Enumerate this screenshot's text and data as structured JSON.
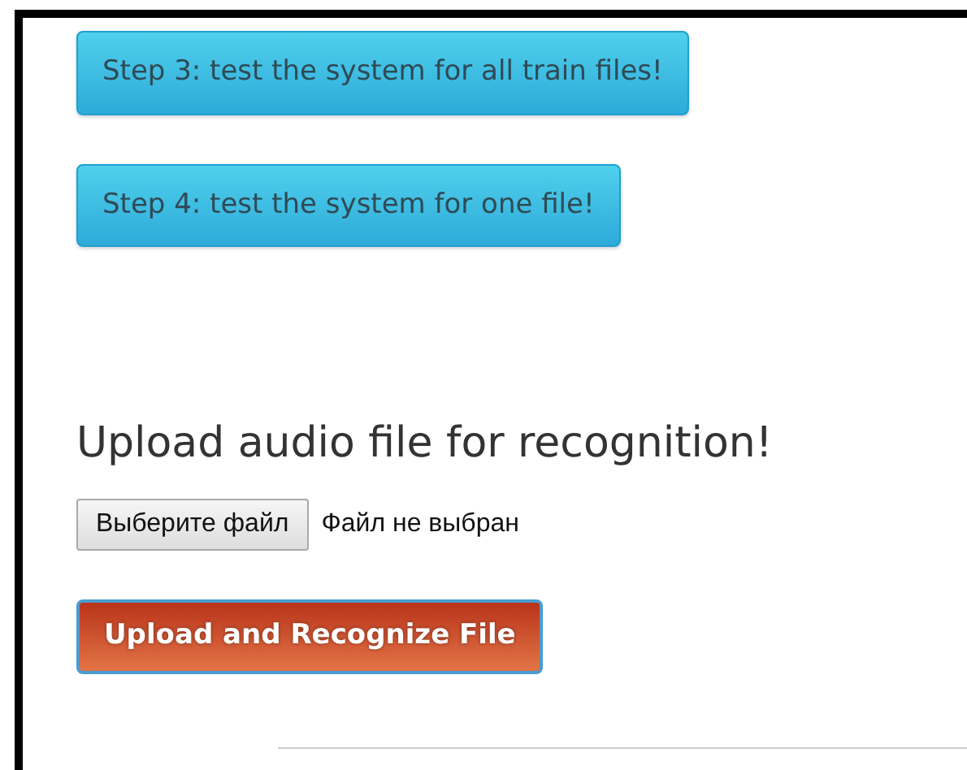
{
  "step_buttons": [
    {
      "label": "Step 3: test the system for all train files!"
    },
    {
      "label": "Step 4: test the system for one file!"
    }
  ],
  "upload_heading": "Upload audio file for recognition!",
  "file_input": {
    "button": "Выберите файл",
    "status": "Файл не выбран"
  },
  "submit_button": {
    "label": "Upload and Recognize File"
  }
}
